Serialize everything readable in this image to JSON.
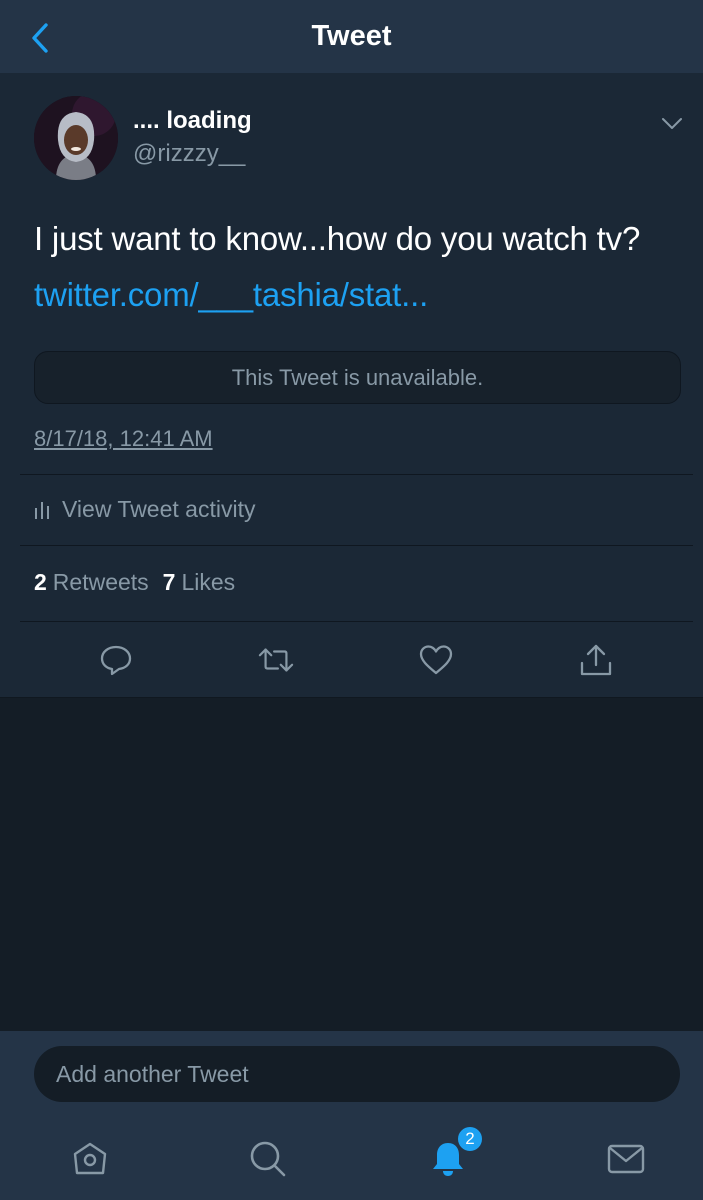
{
  "header": {
    "title": "Tweet",
    "back_icon": "chevron-left-icon",
    "accent": "#1da1f2"
  },
  "tweet": {
    "author_name": ".... loading",
    "author_handle": "@rizzzy__",
    "text": "I just want to know...how do you watch tv?",
    "link": "twitter.com/___tashia/stat...",
    "quoted_status": "This Tweet is unavailable.",
    "timestamp": "8/17/18, 12:41 AM",
    "activity_label": "View Tweet activity",
    "retweets_count": "2",
    "retweets_label": "Retweets",
    "likes_count": "7",
    "likes_label": "Likes"
  },
  "actions": [
    {
      "name": "reply",
      "icon": "reply-icon"
    },
    {
      "name": "retweet",
      "icon": "retweet-icon"
    },
    {
      "name": "like",
      "icon": "heart-icon"
    },
    {
      "name": "share",
      "icon": "share-icon"
    }
  ],
  "compose": {
    "placeholder": "Add another Tweet"
  },
  "tabbar": {
    "items": [
      {
        "name": "home",
        "icon": "home-icon",
        "active": false
      },
      {
        "name": "search",
        "icon": "search-icon",
        "active": false
      },
      {
        "name": "notifications",
        "icon": "bell-icon",
        "active": true,
        "badge": "2"
      },
      {
        "name": "messages",
        "icon": "mail-icon",
        "active": false
      }
    ]
  },
  "colors": {
    "header_bg": "#243447",
    "tweet_bg": "#1b2836",
    "page_bg": "#141d26",
    "muted_text": "#8899a6",
    "link": "#1da1f2"
  }
}
